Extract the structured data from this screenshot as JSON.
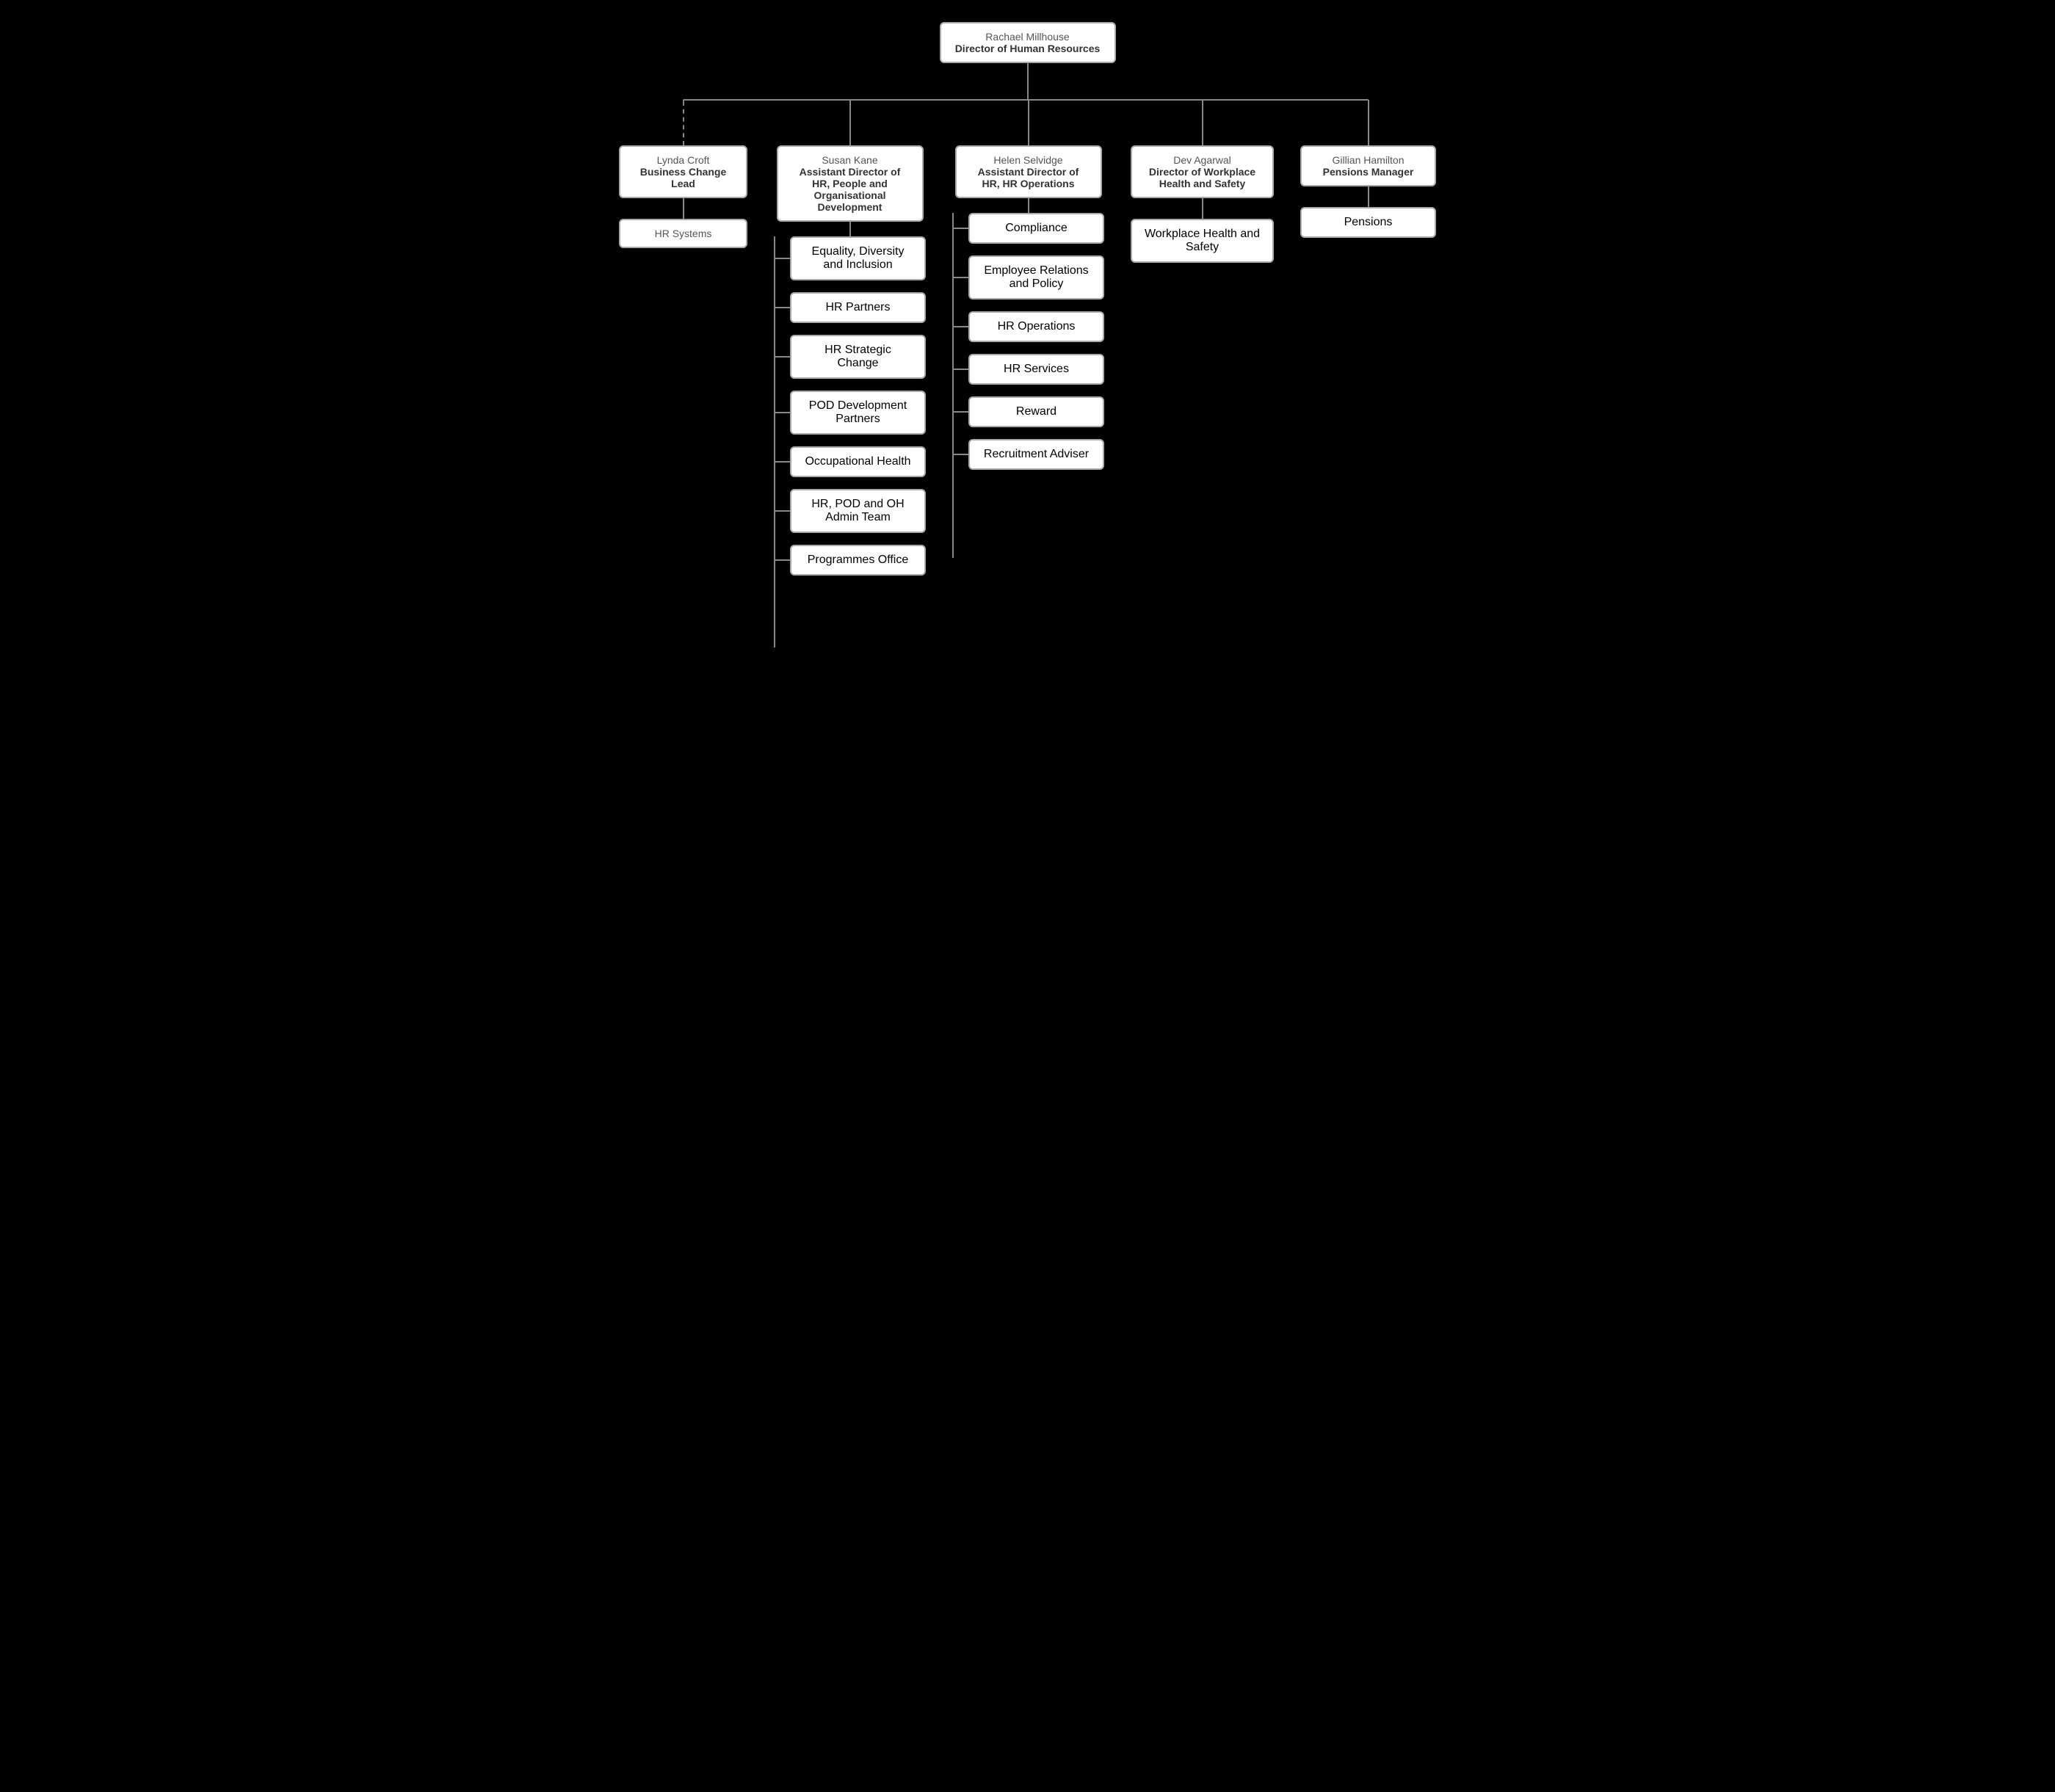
{
  "root": {
    "name": "Rachael Millhouse",
    "title": "Director of Human Resources"
  },
  "tier2": [
    {
      "id": "lynda",
      "name": "Lynda Croft",
      "title": "Business Change Lead",
      "connector": "dashed",
      "children": [
        {
          "label": "HR Systems"
        }
      ]
    },
    {
      "id": "susan",
      "name": "Susan Kane",
      "title": "Assistant Director of HR, People and Organisational Development",
      "children": [
        {
          "label": "Equality, Diversity and Inclusion"
        },
        {
          "label": "HR Partners"
        },
        {
          "label": "HR Strategic Change"
        },
        {
          "label": "POD Development Partners"
        },
        {
          "label": "Occupational Health"
        },
        {
          "label": "HR, POD and OH Admin Team"
        },
        {
          "label": "Programmes Office"
        }
      ]
    },
    {
      "id": "helen",
      "name": "Helen Selvidge",
      "title": "Assistant Director of HR, HR Operations",
      "children": [
        {
          "label": "Compliance"
        },
        {
          "label": "Employee Relations and Policy"
        },
        {
          "label": "HR Operations"
        },
        {
          "label": "HR Services"
        },
        {
          "label": "Reward"
        },
        {
          "label": "Recruitment Adviser"
        }
      ]
    },
    {
      "id": "dev",
      "name": "Dev Agarwal",
      "title": "Director of Workplace Health and Safety",
      "children": [
        {
          "label": "Workplace Health and Safety"
        }
      ]
    },
    {
      "id": "gillian",
      "name": "Gillian Hamilton",
      "title": "Pensions Manager",
      "children": [
        {
          "label": "Pensions"
        }
      ]
    }
  ]
}
